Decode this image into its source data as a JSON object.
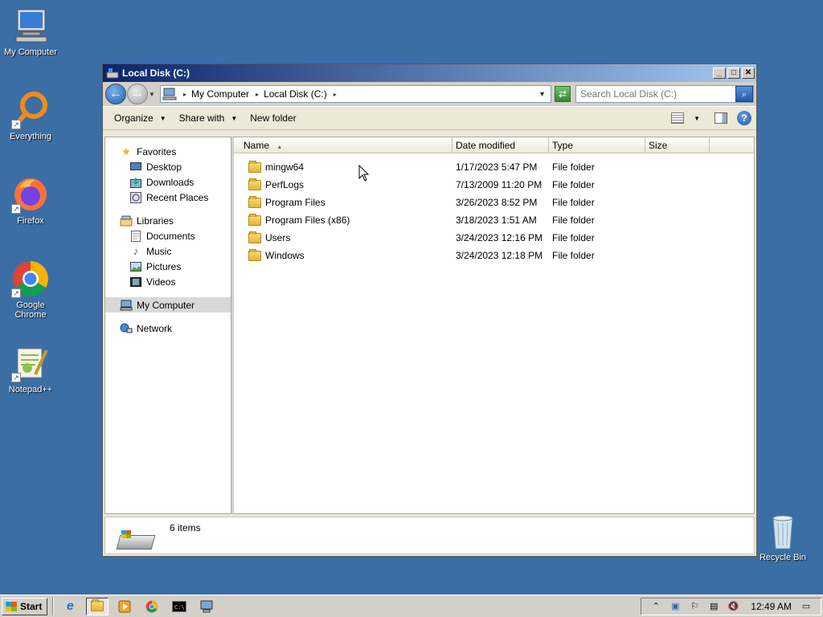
{
  "desktop": {
    "icons": [
      {
        "label": "My Computer"
      },
      {
        "label": "Everything"
      },
      {
        "label": "Firefox"
      },
      {
        "label": "Google Chrome"
      },
      {
        "label": "Notepad++"
      },
      {
        "label": "Recycle Bin"
      }
    ]
  },
  "window": {
    "title": "Local Disk (C:)",
    "breadcrumbs": [
      "My Computer",
      "Local Disk (C:)"
    ],
    "search_placeholder": "Search Local Disk (C:)",
    "toolbar": {
      "organize": "Organize",
      "share_with": "Share with",
      "new_folder": "New folder"
    },
    "nav": {
      "favorites": "Favorites",
      "desktop": "Desktop",
      "downloads": "Downloads",
      "recent_places": "Recent Places",
      "libraries": "Libraries",
      "documents": "Documents",
      "music": "Music",
      "pictures": "Pictures",
      "videos": "Videos",
      "my_computer": "My Computer",
      "network": "Network"
    },
    "columns": {
      "name": "Name",
      "date_modified": "Date modified",
      "type": "Type",
      "size": "Size"
    },
    "files": [
      {
        "name": "mingw64",
        "date": "1/17/2023 5:47 PM",
        "type": "File folder"
      },
      {
        "name": "PerfLogs",
        "date": "7/13/2009 11:20 PM",
        "type": "File folder"
      },
      {
        "name": "Program Files",
        "date": "3/26/2023 8:52 PM",
        "type": "File folder"
      },
      {
        "name": "Program Files (x86)",
        "date": "3/18/2023 1:51 AM",
        "type": "File folder"
      },
      {
        "name": "Users",
        "date": "3/24/2023 12:16 PM",
        "type": "File folder"
      },
      {
        "name": "Windows",
        "date": "3/24/2023 12:18 PM",
        "type": "File folder"
      }
    ],
    "details": {
      "item_count": "6 items"
    }
  },
  "taskbar": {
    "start_label": "Start",
    "clock": "12:49 AM"
  }
}
